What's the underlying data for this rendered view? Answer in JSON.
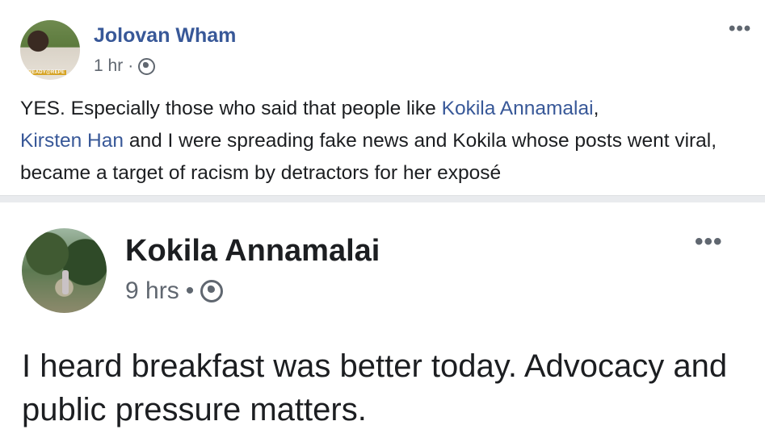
{
  "comment": {
    "author": "Jolovan Wham",
    "avatar_tag": "READY@REPE",
    "time": "1 hr",
    "separator": "·",
    "privacy_icon": "globe-icon",
    "more_icon": "•••",
    "text_part1": "YES. Especially those who said that people like ",
    "link1": "Kokila Annamalai",
    "text_part2": ",",
    "link2": "Kirsten Han",
    "text_part3": " and I were spreading fake news and Kokila whose posts went viral, became a target of racism by detractors for her exposé"
  },
  "shared_post": {
    "author": "Kokila Annamalai",
    "time": "9 hrs",
    "separator": "•",
    "privacy_icon": "globe-icon",
    "more_icon": "•••",
    "text": "I heard breakfast was better today. Advocacy and public pressure matters."
  },
  "colors": {
    "link": "#385898",
    "text": "#1c1e21",
    "meta": "#606770",
    "divider": "#e9ebee"
  }
}
